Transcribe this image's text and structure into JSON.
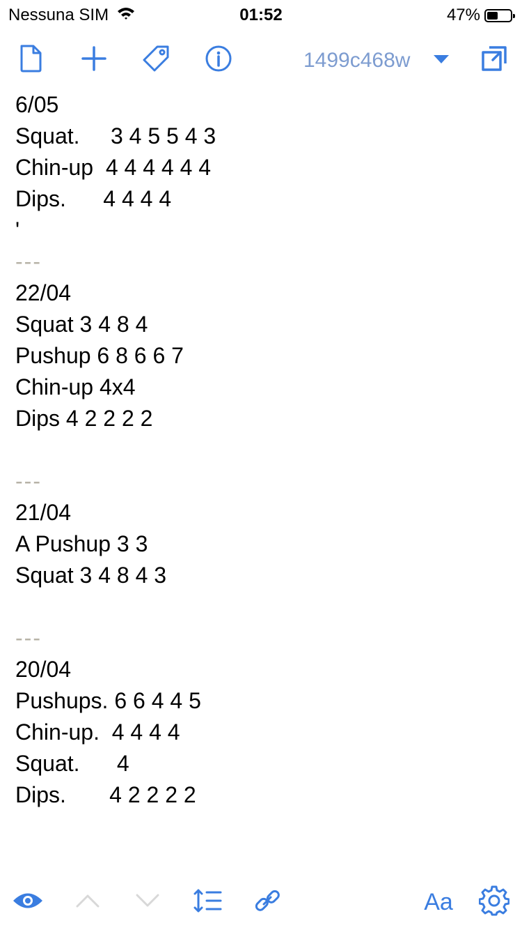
{
  "status": {
    "carrier": "Nessuna SIM",
    "time": "01:52",
    "battery": "47%",
    "battery_level": 0.47
  },
  "toolbar": {
    "icons": [
      "new-document-icon",
      "plus-icon",
      "tag-icon",
      "info-icon",
      "dropdown-caret-icon",
      "expand-icon"
    ],
    "doc_title": "1499c468w",
    "accent": "#3a7de0",
    "title_color": "#7d9cd0"
  },
  "note": {
    "lines": [
      "6/05",
      "Squat.     3 4 5 5 4 3",
      "Chin-up  4 4 4 4 4 4",
      "Dips.      4 4 4 4",
      "'",
      "---",
      "22/04",
      "Squat 3 4 8 4",
      "Pushup 6 8 6 6 7",
      "Chin-up 4x4",
      "Dips 4 2 2 2 2",
      "",
      "---",
      "21/04",
      "A Pushup 3 3",
      "Squat 3 4 8 4 3",
      "",
      "---",
      "20/04",
      "Pushups. 6 6 4 4 5",
      "Chin-up.  4 4 4 4",
      "Squat.      4",
      "Dips.       4 2 2 2 2"
    ],
    "separator_color": "#b7b3a7"
  },
  "bottombar": {
    "icons": [
      "eye-icon",
      "chevron-up-icon",
      "chevron-down-icon",
      "line-spacing-icon",
      "link-icon",
      "font-size-icon",
      "gear-icon"
    ],
    "font_label": "Aa",
    "disabled_color": "#d8d8d8"
  }
}
